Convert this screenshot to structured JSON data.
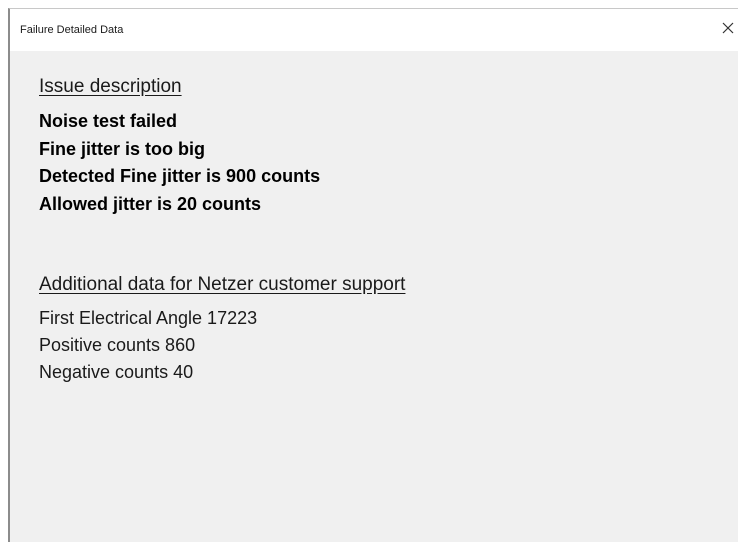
{
  "window": {
    "title": "Failure Detailed Data"
  },
  "issue": {
    "heading": "Issue description",
    "lines": [
      "Noise test failed",
      "Fine jitter is too big",
      "Detected Fine jitter is 900 counts",
      "Allowed jitter is 20 counts"
    ]
  },
  "additional": {
    "heading": "Additional data for Netzer customer support",
    "lines": [
      "First Electrical Angle 17223",
      "Positive counts 860",
      "Negative counts 40"
    ]
  },
  "icons": {
    "close": "close-icon"
  }
}
